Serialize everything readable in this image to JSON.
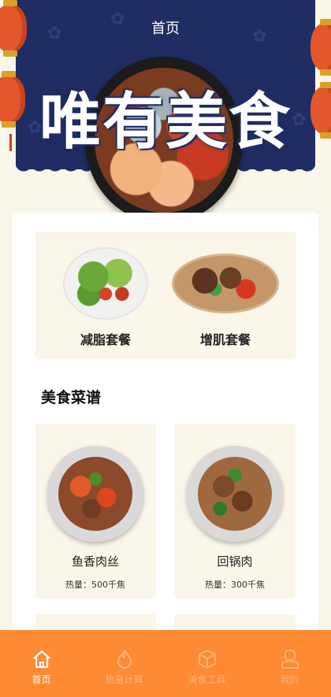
{
  "header": {
    "title": "首页"
  },
  "hero": {
    "brand_text": "唯有美食"
  },
  "combos": [
    {
      "label": "减脂套餐",
      "image": "salad"
    },
    {
      "label": "增肌套餐",
      "image": "beef-stir-fry"
    }
  ],
  "section": {
    "title": "美食菜谱"
  },
  "recipes": [
    {
      "name": "鱼香肉丝",
      "calories": "热量：500千焦",
      "image": "yuxiang-pork"
    },
    {
      "name": "回锅肉",
      "calories": "热量：300千焦",
      "image": "twice-cooked-pork"
    }
  ],
  "tabbar": {
    "items": [
      {
        "label": "首页",
        "icon": "home-icon",
        "active": true
      },
      {
        "label": "热量计算",
        "icon": "flame-icon",
        "active": false
      },
      {
        "label": "美食工具",
        "icon": "box-icon",
        "active": false
      },
      {
        "label": "我的",
        "icon": "user-icon",
        "active": false
      }
    ]
  },
  "colors": {
    "banner": "#1f2d63",
    "tabbar": "#ff8a34",
    "card": "#fbf6ea",
    "lantern": "#e2582b"
  }
}
